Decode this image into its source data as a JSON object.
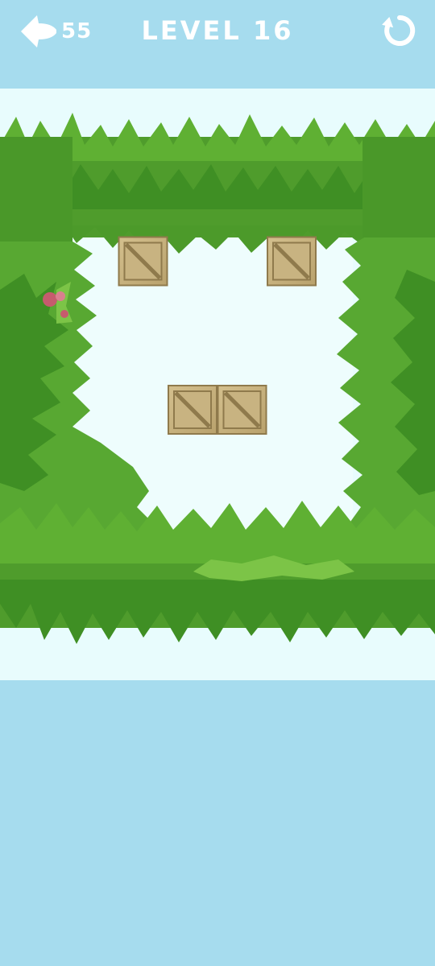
{
  "header": {
    "moves_remaining": "55",
    "level_label": "LEVEL 16"
  },
  "icons": {
    "back": "arrow-left-icon",
    "restart": "restart-icon"
  },
  "colors": {
    "sky": "#a6dcee",
    "board": "#e8fcfd",
    "grass_dark": "#3f8f24",
    "grass_mid": "#58a832",
    "grass_light": "#7cc447",
    "crate_face": "#c8b381",
    "crate_border": "#8f7a4c"
  },
  "board": {
    "crates": [
      {
        "col": 1,
        "row": 1
      },
      {
        "col": 4,
        "row": 1
      },
      {
        "col": 2,
        "row": 4
      },
      {
        "col": 3,
        "row": 4
      }
    ]
  }
}
